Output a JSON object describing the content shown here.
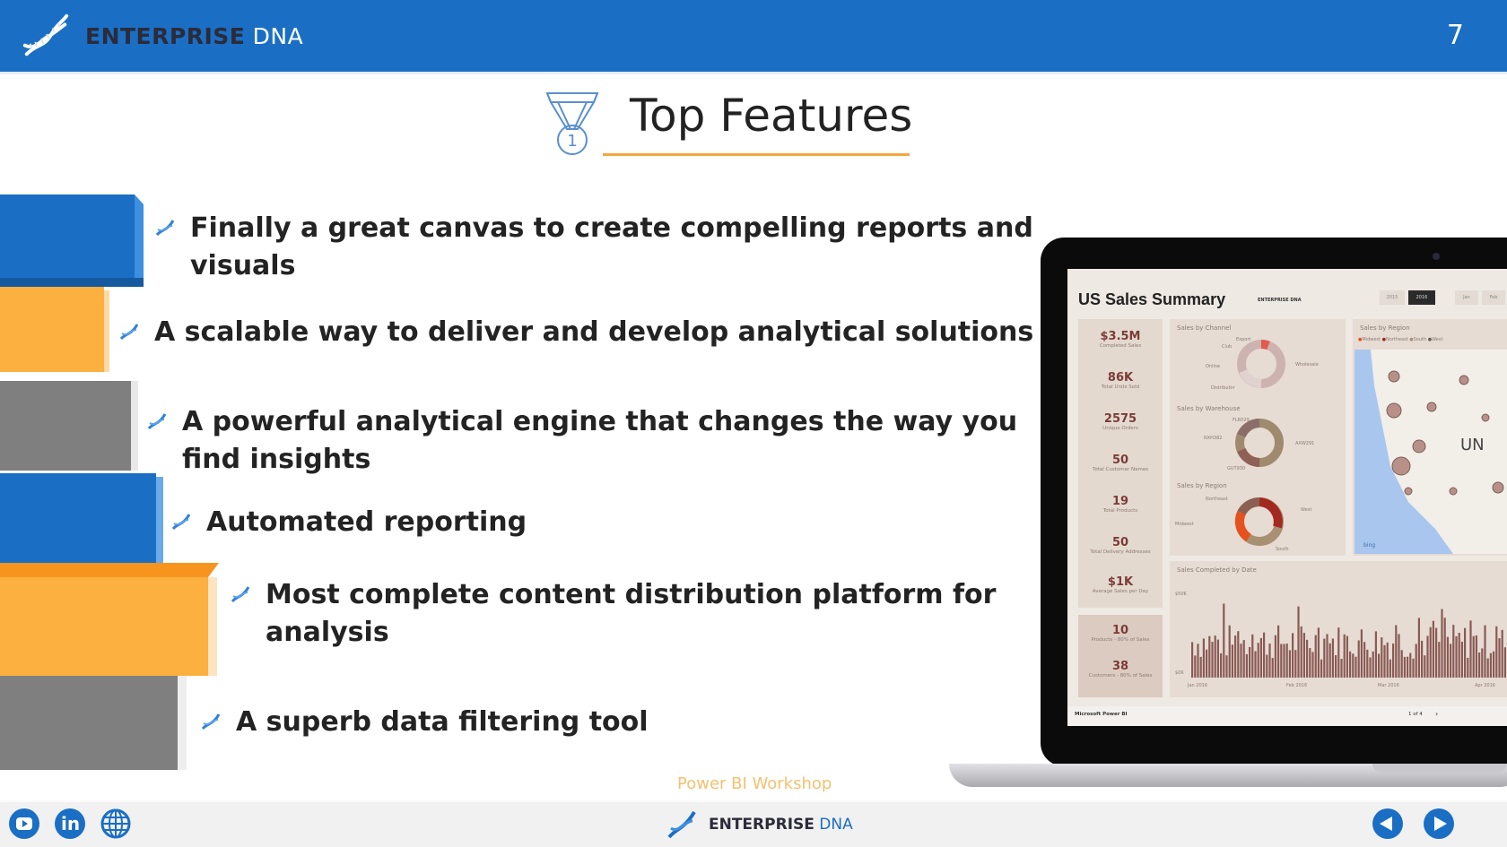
{
  "header": {
    "brand_bold": "ENTERPRISE",
    "brand_light": "DNA",
    "slide_number": "7",
    "colors": {
      "header_bg": "#1a6fc4",
      "accent": "#f5a742"
    }
  },
  "slide": {
    "title": "Top Features",
    "title_icon": "medal-icon",
    "bullets": [
      {
        "line1": "Finally a great canvas to create compelling reports and",
        "line2": "visuals",
        "icon": "dna-icon"
      },
      {
        "line1": "A scalable way to deliver and develop analytical solutions",
        "line2": "",
        "icon": "dna-icon"
      },
      {
        "line1": "A powerful analytical engine that changes the way you",
        "line2": "find insights",
        "icon": "dna-icon"
      },
      {
        "line1": "Automated reporting",
        "line2": "",
        "icon": "dna-icon"
      },
      {
        "line1": "Most complete content distribution platform for",
        "line2": "analysis",
        "icon": "dna-icon"
      },
      {
        "line1": "A superb data filtering tool",
        "line2": "",
        "icon": "dna-icon"
      }
    ],
    "step_colors": [
      "#1a6fc4",
      "#fbb040",
      "#7f7f7f",
      "#1a6fc4",
      "#fbb040",
      "#7f7f7f"
    ]
  },
  "dashboard": {
    "title": "US Sales Summary",
    "brand": "ENTERPRISE DNA",
    "year_buttons": [
      "2015",
      "2016"
    ],
    "selected_year": "2016",
    "month_buttons": [
      "Jan",
      "Feb"
    ],
    "kpis": [
      {
        "value": "$3.5M",
        "label": "Completed Sales"
      },
      {
        "value": "86K",
        "label": "Total Units Sold"
      },
      {
        "value": "2575",
        "label": "Unique Orders"
      },
      {
        "value": "50",
        "label": "Total Customer Names"
      },
      {
        "value": "19",
        "label": "Total Products"
      },
      {
        "value": "50",
        "label": "Total Delivery Addresses"
      },
      {
        "value": "$1K",
        "label": "Average Sales per Day"
      }
    ],
    "kpis2": [
      {
        "value": "10",
        "label": "Products - 80% of Sales"
      },
      {
        "value": "38",
        "label": "Customers - 80% of Sales"
      }
    ],
    "sales_by_channel": {
      "title": "Sales by Channel",
      "labels": [
        "Export",
        "Club",
        "Online",
        "Distributor",
        "Wholesale"
      ]
    },
    "sales_by_warehouse": {
      "title": "Sales by Warehouse",
      "labels": [
        "FLR029",
        "NXH382",
        "GUT930",
        "AXW291"
      ]
    },
    "sales_by_region_donut": {
      "title": "Sales by Region",
      "labels": [
        "Northeast",
        "Midwest",
        "West",
        "South"
      ]
    },
    "sales_by_region_map": {
      "title": "Sales by Region",
      "legend": [
        "Midwest",
        "Northeast",
        "South",
        "West"
      ],
      "map_label": "UN",
      "attribution": "bing"
    },
    "sales_by_date": {
      "title": "Sales Completed by Date",
      "y_top": "$50K",
      "y_bottom": "$0K",
      "x_labels": [
        "Jan 2016",
        "Feb 2016",
        "Mar 2016",
        "Apr 2016"
      ]
    },
    "footer_left": "Microsoft Power BI",
    "pager": "1 of 4"
  },
  "footer": {
    "workshop": "Power BI Workshop",
    "brand_bold": "ENTERPRISE",
    "brand_light": "DNA",
    "social": [
      "youtube-icon",
      "linkedin-icon",
      "globe-icon"
    ],
    "nav": [
      "previous-slide",
      "next-slide"
    ]
  }
}
